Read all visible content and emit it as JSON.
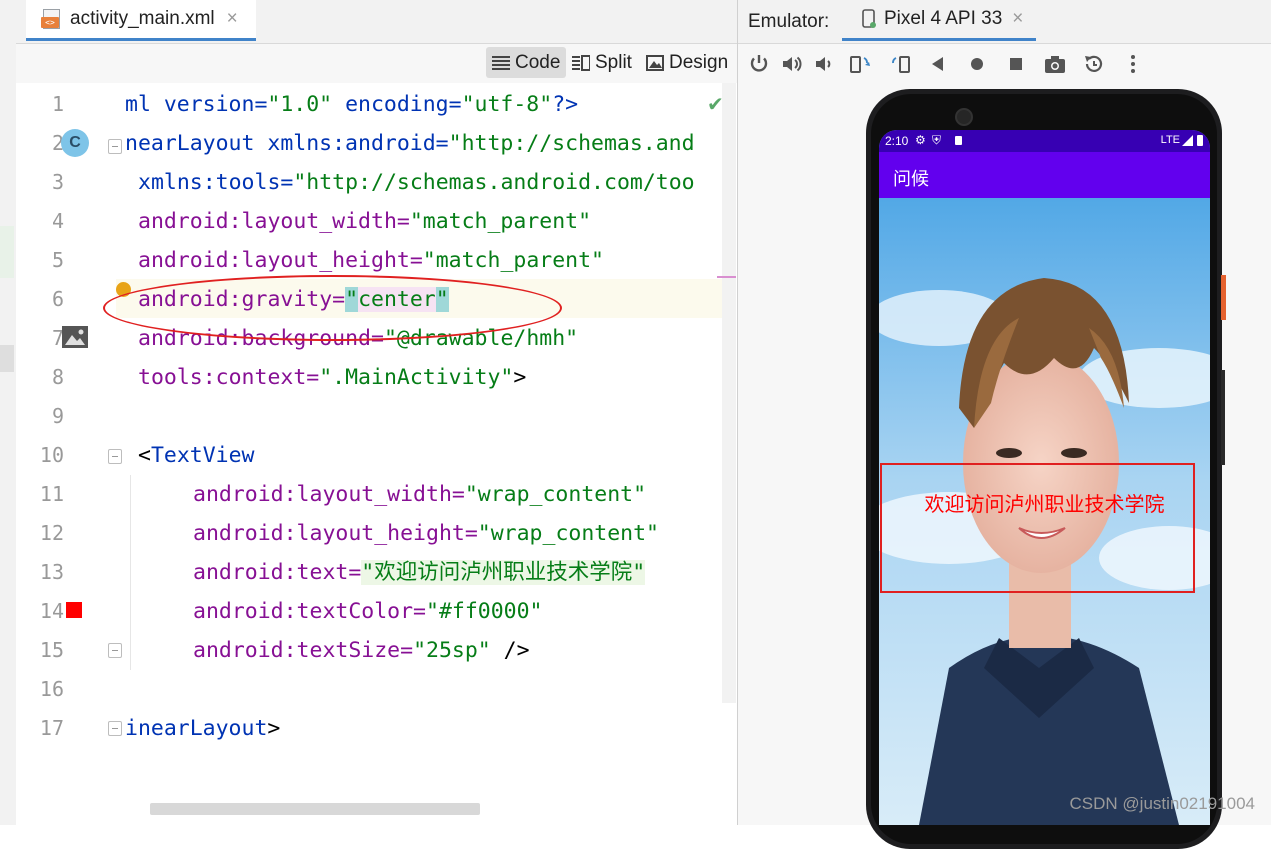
{
  "editor": {
    "file_tab": {
      "label": "activity_main.xml",
      "close": "×"
    },
    "view_modes": {
      "code": "Code",
      "split": "Split",
      "design": "Design"
    },
    "line_numbers": [
      "1",
      "2",
      "3",
      "4",
      "5",
      "6",
      "7",
      "8",
      "9",
      "10",
      "11",
      "12",
      "13",
      "14",
      "15",
      "16",
      "17"
    ],
    "gutter_icons": {
      "class_icon": "C"
    },
    "inspection_icon": "✔",
    "code": {
      "l1": {
        "t1": "ml version=",
        "v1": "\"1.0\"",
        "t2": " encoding=",
        "v2": "\"utf-8\"",
        "t3": "?>"
      },
      "l2": {
        "tag": "nearLayout",
        "attr": " xmlns:android=",
        "val": "\"http://schemas.and"
      },
      "l3": {
        "attr": "xmlns:tools=",
        "val": "\"http://schemas.android.com/too"
      },
      "l4": {
        "attr": "android:layout_width=",
        "val": "\"match_parent\""
      },
      "l5": {
        "attr": "android:layout_height=",
        "val": "\"match_parent\""
      },
      "l6": {
        "attr": "android:gravity=",
        "q1": "\"",
        "val": "center",
        "q2": "\""
      },
      "l7": {
        "attr": "android:background=",
        "val": "\"@drawable/hmh\""
      },
      "l8": {
        "attr": "tools:context=",
        "val": "\".MainActivity\"",
        "end": ">"
      },
      "l10": {
        "open": "<",
        "tag": "TextView"
      },
      "l11": {
        "attr": "android:layout_width=",
        "val": "\"wrap_content\""
      },
      "l12": {
        "attr": "android:layout_height=",
        "val": "\"wrap_content\""
      },
      "l13": {
        "attr": "android:text=",
        "val": "\"欢迎访问泸州职业技术学院\""
      },
      "l14": {
        "attr": "android:textColor=",
        "val": "\"#ff0000\""
      },
      "l15": {
        "attr": "android:textSize=",
        "val": "\"25sp\"",
        "end": " />"
      },
      "l17": {
        "tag": "inearLayout",
        "end": ">"
      }
    }
  },
  "emulator": {
    "label": "Emulator:",
    "device_tab": "Pixel 4 API 33",
    "close": "×",
    "toolbar_icons": [
      "power-icon",
      "volume-up-icon",
      "volume-down-icon",
      "rotate-left-icon",
      "rotate-right-icon",
      "back-icon",
      "home-icon",
      "overview-icon",
      "screenshot-icon",
      "snapshot-icon",
      "more-icon"
    ],
    "phone": {
      "status_time": "2:10",
      "status_right": "LTE",
      "app_title": "问候",
      "hello_text": "欢迎访问泸州职业技术学院"
    }
  },
  "watermark": "CSDN @justin02191004",
  "colors": {
    "accent": "#4083c9",
    "app_bar": "#6200ee",
    "status_bar": "#3700b3",
    "annotation_red": "#e02020",
    "text_red": "#ff0000"
  }
}
